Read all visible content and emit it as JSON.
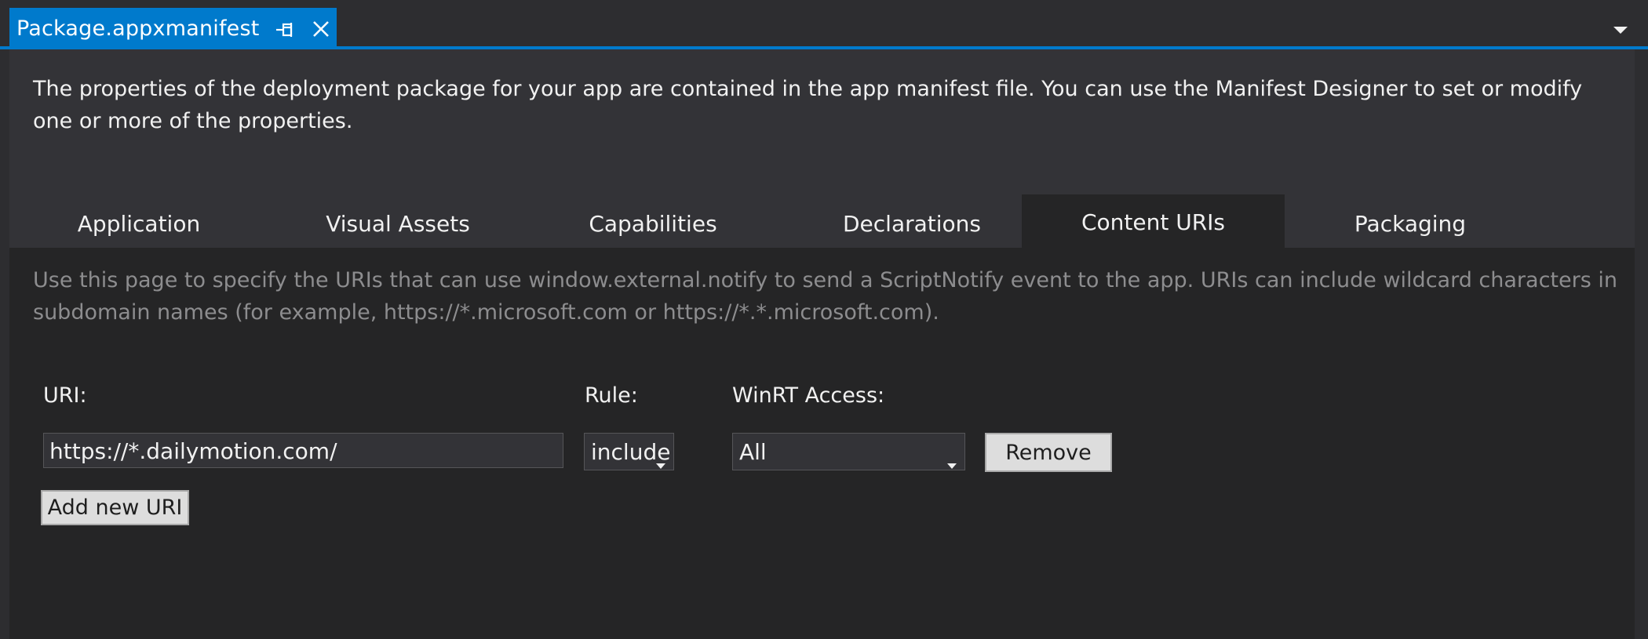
{
  "doc_tab": {
    "title": "Package.appxmanifest",
    "pin_icon": "pin-icon",
    "close_icon": "close-icon"
  },
  "tabstrip": {
    "dropdown_icon": "chevron-down-icon"
  },
  "intro_text": "The properties of the deployment package for your app are contained in the app manifest file. You can use the Manifest Designer to set or modify one or more of the properties.",
  "section_tabs": [
    {
      "label": "Application",
      "active": false
    },
    {
      "label": "Visual Assets",
      "active": false
    },
    {
      "label": "Capabilities",
      "active": false
    },
    {
      "label": "Declarations",
      "active": false
    },
    {
      "label": "Content URIs",
      "active": true
    },
    {
      "label": "Packaging",
      "active": false
    }
  ],
  "content_uris": {
    "description": "Use this page to specify the URIs that can use window.external.notify to send a ScriptNotify event to the app. URIs can include wildcard characters in subdomain names (for example, https://*.microsoft.com or https://*.*.microsoft.com).",
    "labels": {
      "uri": "URI:",
      "rule": "Rule:",
      "winrt_access": "WinRT Access:"
    },
    "rows": [
      {
        "uri": "https://*.dailymotion.com/",
        "rule": "include",
        "winrt_access": "All",
        "remove_label": "Remove"
      }
    ],
    "add_button_label": "Add new URI"
  },
  "colors": {
    "accent": "#007acc",
    "background": "#2d2d30",
    "panel": "#252526",
    "text": "#f1f1f1",
    "muted_text": "#8d8d8f"
  }
}
